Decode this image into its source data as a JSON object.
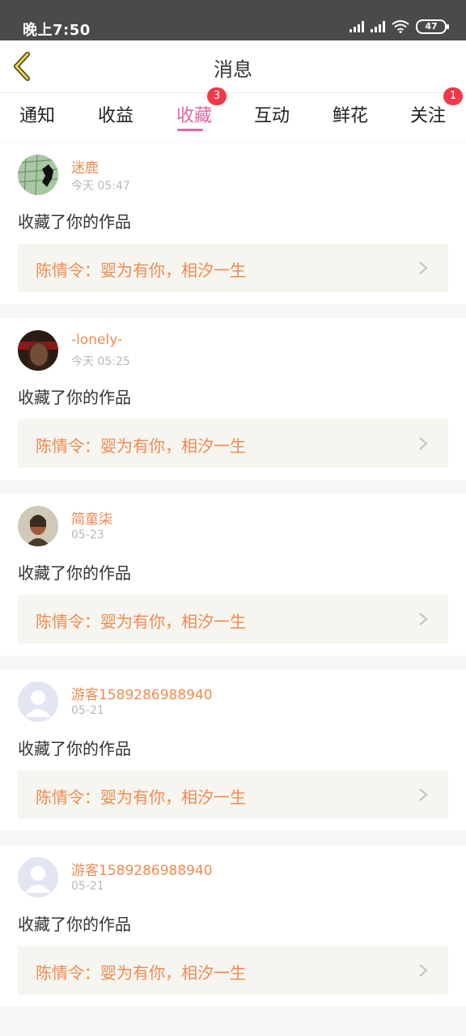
{
  "status_bar": {
    "time": "晚上7:50",
    "battery": "47"
  },
  "header": {
    "title": "消息"
  },
  "tabs": [
    {
      "label": "通知",
      "badge": ""
    },
    {
      "label": "收益",
      "badge": ""
    },
    {
      "label": "收藏",
      "badge": "3",
      "active": true
    },
    {
      "label": "互动",
      "badge": ""
    },
    {
      "label": "鲜花",
      "badge": ""
    },
    {
      "label": "关注",
      "badge": "1"
    }
  ],
  "notifications": [
    {
      "user": "迷鹿",
      "time": "今天 05:47",
      "action": "收藏了你的作品",
      "work_title": "陈情令：婴为有你，相汐一生",
      "avatar": "green-map-avatar"
    },
    {
      "user": "-lonely-",
      "time": "今天 05:25",
      "action": "收藏了你的作品",
      "work_title": "陈情令：婴为有你，相汐一生",
      "avatar": "dark-photo-avatar"
    },
    {
      "user": "简童柒",
      "time": "05-23",
      "action": "收藏了你的作品",
      "work_title": "陈情令：婴为有你，相汐一生",
      "avatar": "portrait-avatar"
    },
    {
      "user": "游客1589286988940",
      "time": "05-21",
      "action": "收藏了你的作品",
      "work_title": "陈情令：婴为有你，相汐一生",
      "avatar": "default-avatar"
    },
    {
      "user": "游客1589286988940",
      "time": "05-21",
      "action": "收藏了你的作品",
      "work_title": "陈情令：婴为有你，相汐一生",
      "avatar": "default-avatar"
    }
  ],
  "colors": {
    "accent": "#e267a5",
    "username": "#f08a50",
    "badge": "#f2394a"
  }
}
